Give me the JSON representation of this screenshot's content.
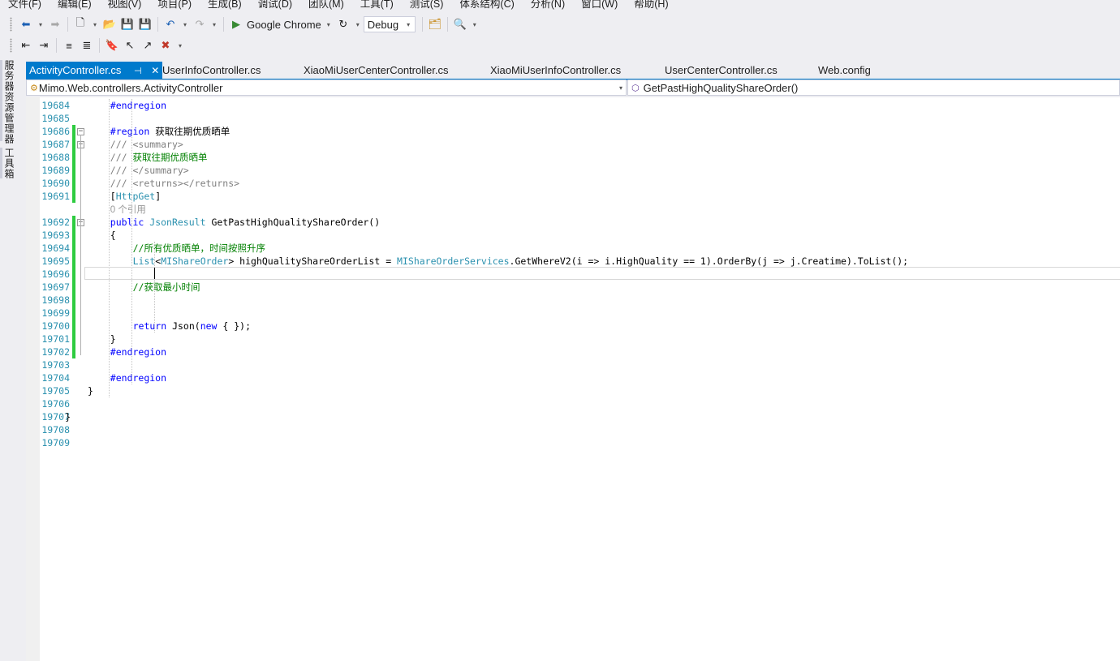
{
  "menu": [
    "文件(F)",
    "编辑(E)",
    "视图(V)",
    "项目(P)",
    "生成(B)",
    "调试(D)",
    "团队(M)",
    "工具(T)",
    "测试(S)",
    "体系结构(C)",
    "分析(N)",
    "窗口(W)",
    "帮助(H)"
  ],
  "toolbar": {
    "browser": "Google Chrome",
    "config": "Debug",
    "icons": [
      "back-icon",
      "forward-icon",
      "new-project-icon",
      "open-icon",
      "save-icon",
      "save-all-icon",
      "undo-icon",
      "redo-icon",
      "start-debug-icon",
      "refresh-icon",
      "find-in-files-icon",
      "solution-explorer-icon"
    ]
  },
  "left_panels": [
    "服务器资源管理器",
    "工具箱"
  ],
  "tabs": [
    {
      "label": "ActivityController.cs",
      "active": true
    },
    {
      "label": "UserInfoController.cs"
    },
    {
      "label": "XiaoMiUserCenterController.cs"
    },
    {
      "label": "XiaoMiUserInfoController.cs"
    },
    {
      "label": "UserCenterController.cs"
    },
    {
      "label": "Web.config"
    }
  ],
  "tab_pin": "⊣",
  "tab_close": "✕",
  "nav": {
    "class_path": "Mimo.Web.controllers.ActivityController",
    "member": "GetPastHighQualityShareOrder()"
  },
  "code": {
    "lines": [
      {
        "n": "19684",
        "segments": [
          {
            "t": "#endregion",
            "c": "kw"
          }
        ]
      },
      {
        "n": "19685",
        "segments": []
      },
      {
        "n": "19686",
        "segments": [
          {
            "t": "#region",
            "c": "kw"
          },
          {
            "t": " 获取往期优质晒单",
            "c": "tx"
          }
        ]
      },
      {
        "n": "19687",
        "segments": [
          {
            "t": "/// <summary>",
            "c": "doc"
          }
        ]
      },
      {
        "n": "19688",
        "segments": [
          {
            "t": "/// ",
            "c": "doc"
          },
          {
            "t": "获取往期优质晒单",
            "c": "cm"
          }
        ]
      },
      {
        "n": "19689",
        "segments": [
          {
            "t": "/// </summary>",
            "c": "doc"
          }
        ]
      },
      {
        "n": "19690",
        "segments": [
          {
            "t": "/// <returns></returns>",
            "c": "doc"
          }
        ]
      },
      {
        "n": "19691",
        "segments": [
          {
            "t": "[",
            "c": "tx"
          },
          {
            "t": "HttpGet",
            "c": "ty"
          },
          {
            "t": "]",
            "c": "tx"
          }
        ]
      },
      {
        "n": "",
        "segments": [
          {
            "t": "0 个引用",
            "c": "ref"
          }
        ]
      },
      {
        "n": "19692",
        "segments": [
          {
            "t": "public ",
            "c": "kw"
          },
          {
            "t": "JsonResult",
            "c": "ty"
          },
          {
            "t": " GetPastHighQualityShareOrder()",
            "c": "tx"
          }
        ]
      },
      {
        "n": "19693",
        "segments": [
          {
            "t": "{",
            "c": "tx"
          }
        ]
      },
      {
        "n": "19694",
        "segments": [
          {
            "t": "//所有优质晒单，时间按照升序",
            "c": "cm"
          }
        ]
      },
      {
        "n": "19695",
        "segments": [
          {
            "t": "List",
            "c": "ty"
          },
          {
            "t": "<",
            "c": "tx"
          },
          {
            "t": "MIShareOrder",
            "c": "ty"
          },
          {
            "t": "> highQualityShareOrderList = ",
            "c": "tx"
          },
          {
            "t": "MIShareOrderServices",
            "c": "ty"
          },
          {
            "t": ".GetWhereV2(i => i.HighQuality == 1).OrderBy(j => j.Creatime).ToList();",
            "c": "tx"
          }
        ]
      },
      {
        "n": "19696",
        "segments": []
      },
      {
        "n": "19697",
        "segments": [
          {
            "t": "//获取最小时间",
            "c": "cm"
          }
        ]
      },
      {
        "n": "19698",
        "segments": []
      },
      {
        "n": "19699",
        "segments": []
      },
      {
        "n": "19700",
        "segments": [
          {
            "t": "return ",
            "c": "kw"
          },
          {
            "t": "Json(",
            "c": "tx"
          },
          {
            "t": "new",
            "c": "kw"
          },
          {
            "t": " { });",
            "c": "tx"
          }
        ]
      },
      {
        "n": "19701",
        "segments": [
          {
            "t": "}",
            "c": "tx"
          }
        ]
      },
      {
        "n": "19702",
        "segments": [
          {
            "t": "#endregion",
            "c": "kw"
          }
        ]
      },
      {
        "n": "19703",
        "segments": []
      },
      {
        "n": "19704",
        "segments": [
          {
            "t": "#endregion",
            "c": "kw"
          }
        ]
      },
      {
        "n": "19705",
        "segments": [
          {
            "t": "}",
            "c": "tx"
          }
        ]
      },
      {
        "n": "19706",
        "segments": []
      },
      {
        "n": "19707",
        "segments": [
          {
            "t": "}",
            "c": "tx"
          }
        ]
      },
      {
        "n": "19708",
        "segments": []
      },
      {
        "n": "19709",
        "segments": []
      }
    ]
  },
  "colors": {
    "accent": "#007acc",
    "keyword": "#0000ff",
    "type": "#2b91af",
    "comment": "#008000",
    "doc_comment": "#808080",
    "change_bar": "#2ecc40"
  }
}
